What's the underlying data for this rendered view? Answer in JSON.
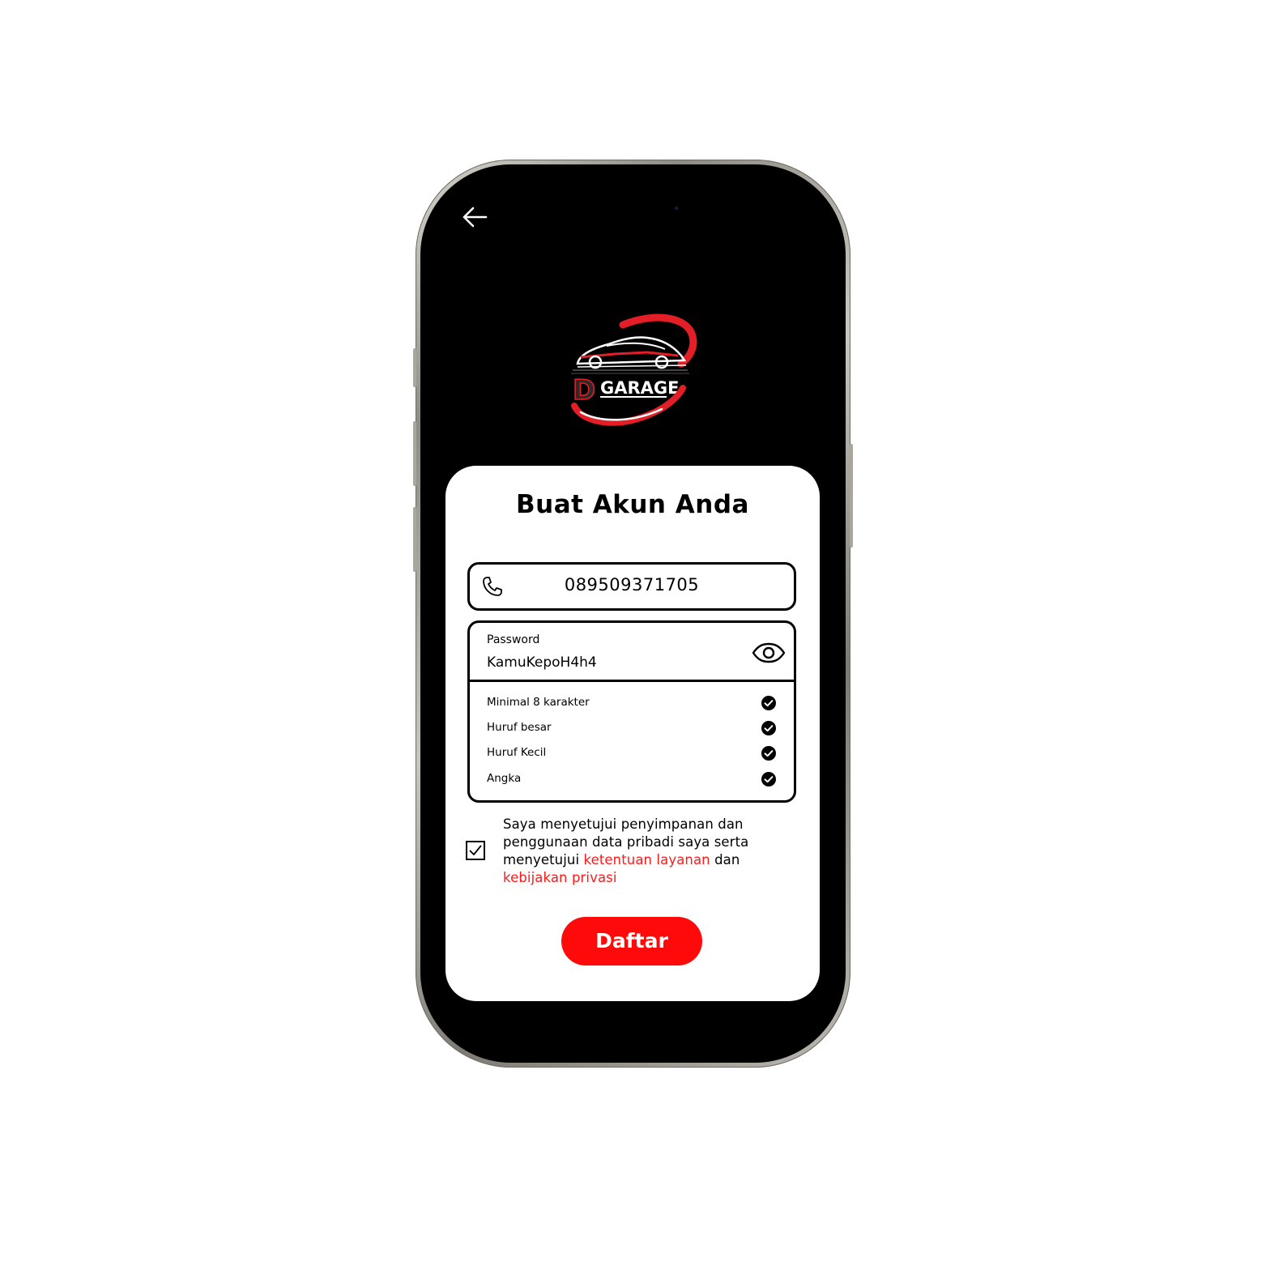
{
  "logo": {
    "brand_letter": "D",
    "brand_name": "GARAGE"
  },
  "form": {
    "title": "Buat Akun Anda",
    "phone_value": "089509371705",
    "password_label": "Password",
    "password_value": "KamuKepoH4h4",
    "rules": [
      {
        "label": "Minimal 8 karakter",
        "met": true
      },
      {
        "label": "Huruf besar",
        "met": true
      },
      {
        "label": "Huruf Kecil",
        "met": true
      },
      {
        "label": "Angka",
        "met": true
      }
    ],
    "consent": {
      "checked": true,
      "text_before": "Saya menyetujui penyimpanan dan penggunaan data pribadi saya serta menyetujui ",
      "terms_link": "ketentuan layanan",
      "text_middle": " dan ",
      "privacy_link": "kebijakan privasi"
    },
    "submit_label": "Daftar"
  },
  "colors": {
    "accent": "#ff0a0a",
    "link": "#ff1a1a",
    "screen_bg": "#000000",
    "card_bg": "#ffffff"
  },
  "icons": {
    "back": "arrow-left-icon",
    "phone": "phone-icon",
    "eye": "eye-icon",
    "check": "check-circle-icon",
    "checkbox": "checkbox-checked-icon"
  }
}
